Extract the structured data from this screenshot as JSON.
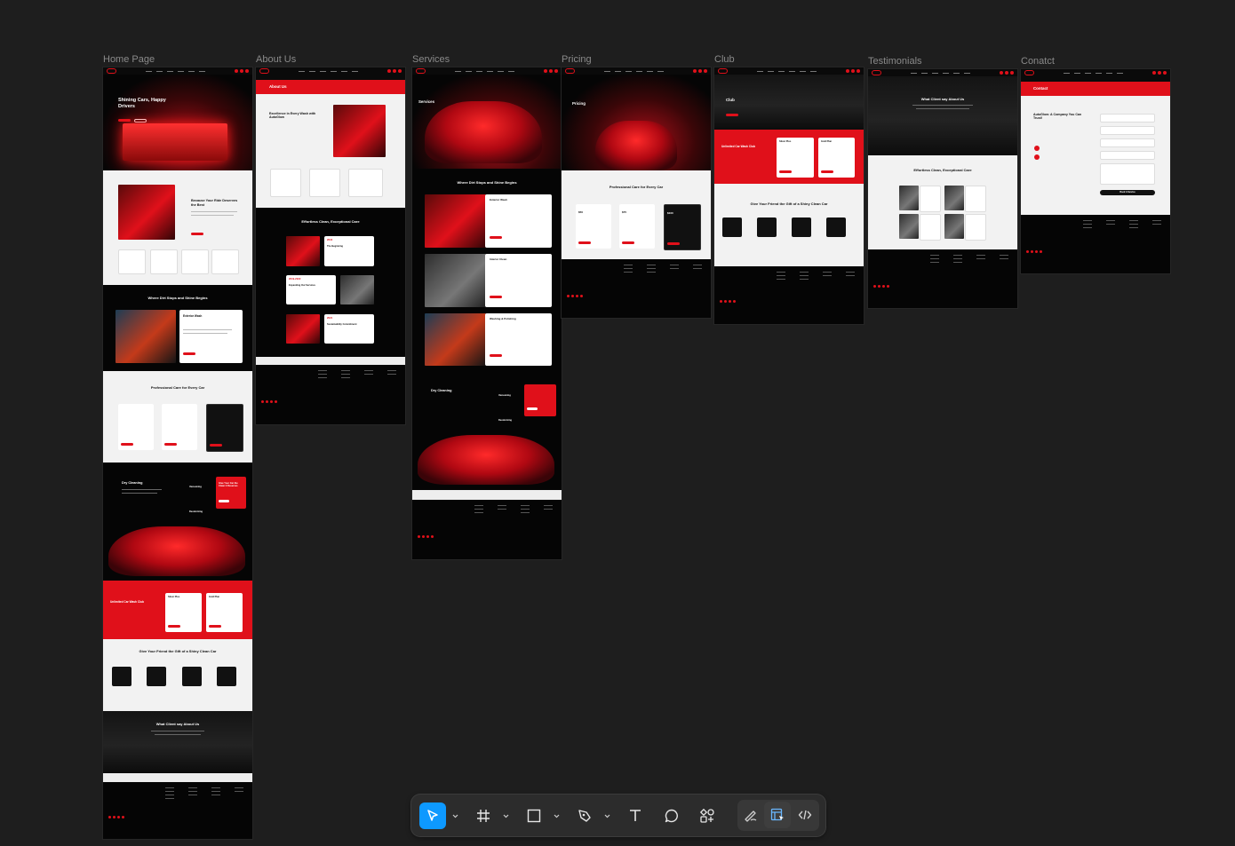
{
  "canvas": {
    "frames": [
      {
        "label": "Home Page"
      },
      {
        "label": "About Us"
      },
      {
        "label": "Services"
      },
      {
        "label": "Pricing"
      },
      {
        "label": "Club"
      },
      {
        "label": "Testimonials"
      },
      {
        "label": "Conatct"
      }
    ]
  },
  "home": {
    "hero_title": "Shining Cars, Happy Drivers",
    "about_title": "Because Your Ride Deserves the Best",
    "dirt_title": "Where Dirt Stops and Shine Begins",
    "exterior_title": "Exterior Wash",
    "care_title": "Professional Care for Every Car",
    "dry_title": "Dry Cleaning",
    "club_title": "Unlimited Car Wash Club",
    "gift_title": "Give Your Friend the Gift of a Shiny Clean Car",
    "testimonials_title": "What Client say About Us",
    "plan_silver": "Silver Plus",
    "plan_gold": "Gold Plan",
    "vacuuming": "Vacuuming",
    "deodorizing": "Deodorizing",
    "gift_cta": "Give Your Car the Clean it Deserves"
  },
  "about": {
    "banner_title": "About Us",
    "excellence_title": "Excellence in Every Wash with AutoGlow",
    "effortless_title": "Effortless Clean, Exceptional Care",
    "t1_year": "2016",
    "t1_title": "The Beginning",
    "t2_year": "2019-2022",
    "t2_title": "Expanding Our Services",
    "t3_year": "2021",
    "t3_title": "Sustainability Commitment"
  },
  "services": {
    "hero_title": "Services",
    "dirt_title": "Where Dirt Stops and Shine Begins",
    "s1": "Exterior Wash",
    "s2": "Interior Clean",
    "s3": "Washing & Polishing",
    "dry_title": "Dry Cleaning",
    "vacuuming": "Vacuuming",
    "deodorizing": "Deodorizing"
  },
  "pricing": {
    "hero_title": "Pricing",
    "care_title": "Professional Care for Every Car",
    "price_1": "$50",
    "price_2": "$75",
    "price_3": "$100"
  },
  "club": {
    "hero_title": "Club",
    "club_title": "Unlimited Car Wash Club",
    "plan_silver": "Silver Plus",
    "plan_gold": "Gold Plan",
    "gift_title": "Give Your Friend the Gift of a Shiny Clean Car"
  },
  "testimonials": {
    "hero_title": "What Client say About Us",
    "effortless_title": "Effortless Clean, Exceptional Care"
  },
  "contact": {
    "banner_title": "Contact",
    "company_title": "AutoGlow: A Company You Can Trust!",
    "submit_label": "Book A Service"
  },
  "toolbar": {
    "tools": [
      {
        "name": "move-tool",
        "icon": "cursor-arrow-icon"
      },
      {
        "name": "frame-tool",
        "icon": "hash-frame-icon"
      },
      {
        "name": "shape-tool",
        "icon": "rectangle-icon"
      },
      {
        "name": "pen-tool",
        "icon": "pen-nib-icon"
      },
      {
        "name": "text-tool",
        "icon": "text-t-icon"
      },
      {
        "name": "comment-tool",
        "icon": "speech-bubble-icon"
      },
      {
        "name": "actions-tool",
        "icon": "components-icon"
      },
      {
        "name": "draw-mode",
        "icon": "pencil-scribble-icon"
      },
      {
        "name": "design-mode",
        "icon": "layout-design-icon"
      },
      {
        "name": "dev-mode",
        "icon": "code-brackets-icon"
      }
    ],
    "accent": "#0d99ff"
  },
  "colors": {
    "brand_red": "#e0101a",
    "canvas_bg": "#1e1e1e"
  }
}
